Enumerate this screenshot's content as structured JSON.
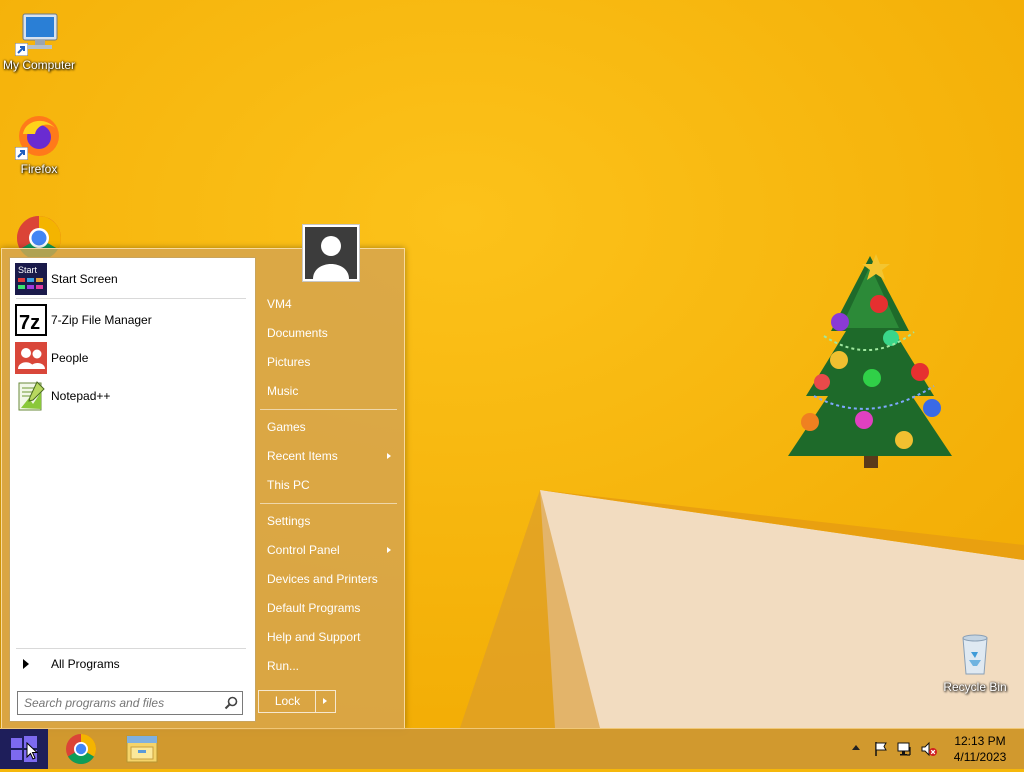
{
  "desktop": {
    "icons": [
      {
        "label": "My Computer",
        "icon": "computer-icon"
      },
      {
        "label": "Firefox",
        "icon": "firefox-icon"
      },
      {
        "label": "",
        "icon": "chrome-icon"
      },
      {
        "label": "Recycle Bin",
        "icon": "recycle-bin-icon"
      }
    ]
  },
  "start_menu": {
    "programs": [
      {
        "label": "Start Screen",
        "icon": "start-screen-icon",
        "icon_text": "Start"
      },
      {
        "label": "7-Zip File Manager",
        "icon": "7zip-icon",
        "icon_text": "7z"
      },
      {
        "label": "People",
        "icon": "people-icon"
      },
      {
        "label": "Notepad++",
        "icon": "notepadpp-icon"
      }
    ],
    "all_programs": "All Programs",
    "search_placeholder": "Search programs and files",
    "right_items": [
      {
        "label": "VM4"
      },
      {
        "label": "Documents"
      },
      {
        "label": "Pictures"
      },
      {
        "label": "Music"
      },
      {
        "label": "Games"
      },
      {
        "label": "Recent Items",
        "submenu": true
      },
      {
        "label": "This PC"
      },
      {
        "label": "Settings"
      },
      {
        "label": "Control Panel",
        "submenu": true
      },
      {
        "label": "Devices and Printers"
      },
      {
        "label": "Default Programs"
      },
      {
        "label": "Help and Support"
      },
      {
        "label": "Run..."
      }
    ],
    "lock_label": "Lock"
  },
  "taskbar": {
    "apps": [
      {
        "icon": "chrome-icon"
      },
      {
        "icon": "file-explorer-icon"
      }
    ],
    "tray_icons": [
      "show-hidden-icons-icon",
      "action-center-flag-icon",
      "network-icon",
      "volume-muted-icon"
    ],
    "clock_time": "12:13 PM",
    "clock_date": "4/11/2023"
  },
  "colors": {
    "desktop_orange": "#f6b80a",
    "start_menu_tan": "#d4a450",
    "start_button": "#1e1e5a"
  }
}
